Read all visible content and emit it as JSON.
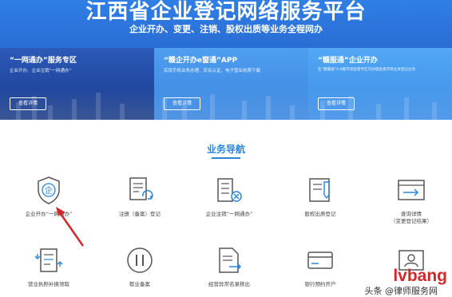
{
  "hero": {
    "title": "江西省企业登记网络服务平台",
    "subtitle": "企业开办、变更、注销、股权出质等业务全程网办"
  },
  "cards": [
    {
      "title": "“一网通办”服务专区",
      "desc": "企业开办、企业注销“一网通办”",
      "button": "查看详情"
    },
    {
      "title": "“赣企开办e窗通”APP",
      "desc": "实现手机业务办理、实名认证、电子营业执照下载",
      "button": "查看详情"
    },
    {
      "title": "“赣服通”企业开办",
      "desc": "在“赣服通”4.0版市场监管专区可办理各类市场主体登记业务",
      "button": "查看详情"
    }
  ],
  "section": {
    "title": "业务导航"
  },
  "nav": [
    {
      "label": "企业开办“一网通办”",
      "icon": "shield-icon"
    },
    {
      "label": "注册（备案）登记",
      "icon": "document-refresh-icon"
    },
    {
      "label": "企业注销“一网通办”",
      "icon": "building-cancel-icon"
    },
    {
      "label": "股权出质登记",
      "icon": "edit-document-icon"
    },
    {
      "label": "查询详情\n（变更登记结果）",
      "icon": "window-arrow-icon"
    },
    {
      "label": "营业执照补换领取",
      "icon": "license-exchange-icon"
    },
    {
      "label": "歇业备案",
      "icon": "pause-icon"
    },
    {
      "label": "经营异常名录移出",
      "icon": "document-arrow-icon"
    },
    {
      "label": "银行预约开户",
      "icon": "bank-card-icon"
    },
    {
      "label": "",
      "icon": "id-card-icon"
    }
  ],
  "watermark": {
    "text": "lvbang",
    "foot": "头条 @律师服务网"
  },
  "colors": {
    "accent": "#2a86d9",
    "hero": "#2a6fd6",
    "arrow": "#d0292a"
  }
}
